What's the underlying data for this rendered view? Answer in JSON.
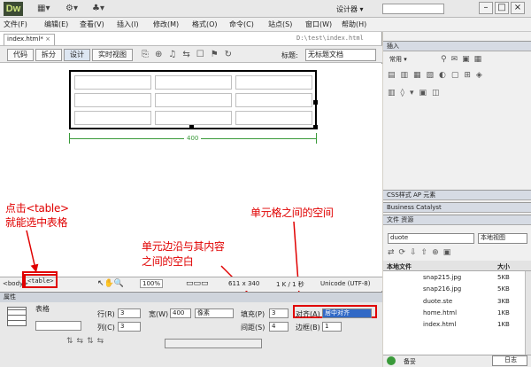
{
  "app": {
    "logo": "Dw",
    "workspace": "设计器"
  },
  "menu": [
    "文件(F)",
    "编辑(E)",
    "查看(V)",
    "插入(I)",
    "修改(M)",
    "格式(O)",
    "命令(C)",
    "站点(S)",
    "窗口(W)",
    "帮助(H)"
  ],
  "document": {
    "tab": "index.html*",
    "path": "D:\\test\\index.html"
  },
  "toolbar": {
    "code": "代码",
    "split": "拆分",
    "design": "设计",
    "live": "实时视图",
    "title_label": "标题:",
    "title_value": "无标题文档"
  },
  "table": {
    "width_label": "400"
  },
  "annotations": {
    "click_table": "点击<table>",
    "select_table": "就能选中表格",
    "cell_spacing": "单元格之间的空间",
    "cell_padding_1": "单元边沿与其内容",
    "cell_padding_2": "之间的空白"
  },
  "status": {
    "tag_body": "<body>",
    "tag_table": "<table>",
    "zoom": "100%",
    "size": "611 x 340",
    "file": "1 K / 1 秒",
    "encoding": "Unicode (UTF-8)"
  },
  "properties": {
    "header": "属性",
    "table_label": "表格",
    "rows_label": "行(R)",
    "rows": "3",
    "cols_label": "列(C)",
    "cols": "3",
    "width_label": "宽(W)",
    "width": "400",
    "width_unit": "像素",
    "padding_label": "填充(P)",
    "padding": "3",
    "spacing_label": "间距(S)",
    "spacing": "4",
    "align_label": "对齐(A)",
    "align": "居中对齐",
    "border_label": "边框(B)",
    "border": "1"
  },
  "panels": {
    "insert": "插入",
    "insert_category": "常用",
    "css": "CSS样式",
    "ap": "AP 元素",
    "bc": "Business Catalyst",
    "files": "文件",
    "assets": "资源",
    "site": "duote",
    "view": "本地视图",
    "col_local": "本地文件",
    "col_size": "大小",
    "file_list": [
      {
        "name": "snap215.jpg",
        "size": "5KB"
      },
      {
        "name": "snap216.jpg",
        "size": "5KB"
      },
      {
        "name": "duote.ste",
        "size": "3KB"
      },
      {
        "name": "home.html",
        "size": "1KB"
      },
      {
        "name": "index.html",
        "size": "1KB"
      }
    ],
    "date": "日志",
    "ready": "备妥"
  }
}
